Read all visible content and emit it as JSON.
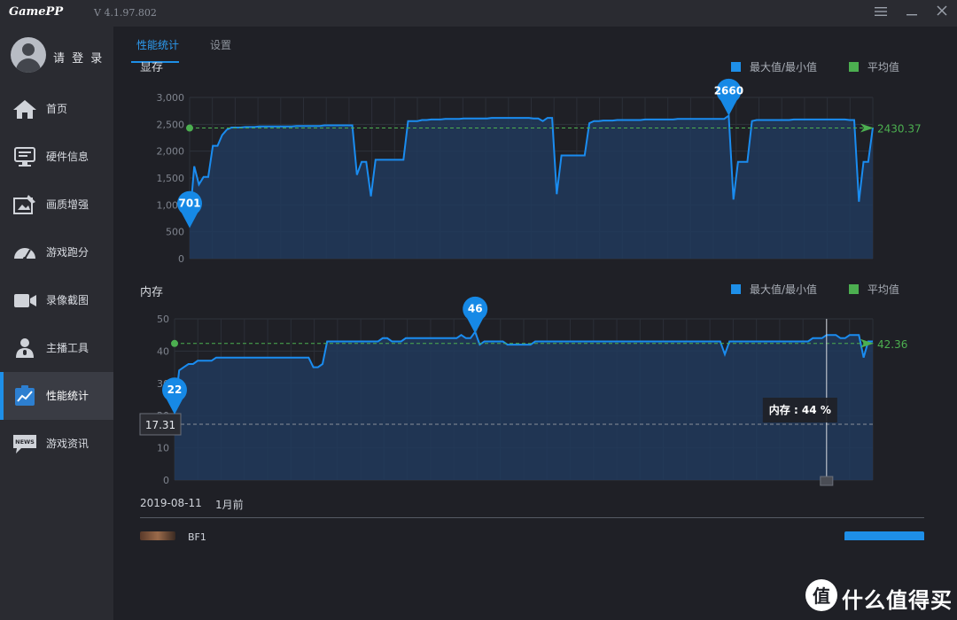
{
  "titlebar": {
    "logo": "GamePP",
    "version": "V 4.1.97.802"
  },
  "user": {
    "login_label": "请 登 录"
  },
  "sidebar": {
    "items": [
      {
        "label": "首页",
        "icon": "home-icon"
      },
      {
        "label": "硬件信息",
        "icon": "hardware-icon"
      },
      {
        "label": "画质增强",
        "icon": "image-enhance-icon"
      },
      {
        "label": "游戏跑分",
        "icon": "speedometer-icon"
      },
      {
        "label": "录像截图",
        "icon": "video-camera-icon"
      },
      {
        "label": "主播工具",
        "icon": "streamer-icon"
      },
      {
        "label": "性能统计",
        "icon": "chart-stats-icon",
        "active": true
      },
      {
        "label": "游戏资讯",
        "icon": "news-icon"
      }
    ]
  },
  "tabs": [
    {
      "label": "性能统计",
      "active": true
    },
    {
      "label": "设置"
    }
  ],
  "colors": {
    "accent": "#1e8fe8",
    "line": "#1a8cf0",
    "average": "#4caf50",
    "area": "#213a5c"
  },
  "chart_data": [
    {
      "type": "area",
      "title": "显存",
      "legend": [
        "最大值/最小值",
        "平均值"
      ],
      "legend_position": "top-right",
      "ylim": [
        0,
        3000
      ],
      "yticks": [
        "0",
        "500",
        "1,000",
        "1,500",
        "2,000",
        "2,500",
        "3,000"
      ],
      "grid": true,
      "max_marker": "2660",
      "min_marker": "701",
      "average_label": "2430.37",
      "average": 2430.37,
      "series": [
        {
          "values": [
            701,
            1720,
            1380,
            1520,
            1520,
            2100,
            2100,
            2300,
            2400,
            2440,
            2440,
            2440,
            2450,
            2450,
            2450,
            2460,
            2460,
            2460,
            2460,
            2460,
            2460,
            2460,
            2460,
            2470,
            2470,
            2470,
            2470,
            2470,
            2470,
            2480,
            2480,
            2480,
            2480,
            2480,
            2480,
            2480,
            1560,
            1800,
            1800,
            1160,
            1840,
            1840,
            1840,
            1840,
            1840,
            1840,
            1840,
            2560,
            2560,
            2560,
            2580,
            2580,
            2590,
            2590,
            2590,
            2600,
            2600,
            2600,
            2600,
            2610,
            2610,
            2610,
            2610,
            2610,
            2610,
            2620,
            2620,
            2620,
            2620,
            2620,
            2620,
            2620,
            2620,
            2620,
            2610,
            2610,
            2560,
            2620,
            2620,
            1200,
            1920,
            1920,
            1920,
            1920,
            1920,
            1920,
            2520,
            2560,
            2560,
            2570,
            2570,
            2570,
            2580,
            2580,
            2580,
            2580,
            2580,
            2580,
            2590,
            2590,
            2590,
            2590,
            2590,
            2590,
            2590,
            2600,
            2600,
            2600,
            2600,
            2600,
            2600,
            2600,
            2600,
            2600,
            2600,
            2600,
            2660,
            1100,
            1800,
            1800,
            1800,
            2560,
            2580,
            2580,
            2580,
            2580,
            2580,
            2580,
            2580,
            2580,
            2590,
            2590,
            2590,
            2590,
            2590,
            2590,
            2590,
            2590,
            2590,
            2590,
            2590,
            2590,
            2580,
            2580,
            1060,
            1800,
            1800,
            2440
          ]
        }
      ]
    },
    {
      "type": "area",
      "title": "内存",
      "legend": [
        "最大值/最小值",
        "平均值"
      ],
      "legend_position": "top-right",
      "ylim": [
        0,
        50
      ],
      "yticks": [
        "0",
        "10",
        "20",
        "30",
        "40",
        "50"
      ],
      "grid": true,
      "max_marker": "46",
      "min_marker": "22",
      "average_label": "42.36",
      "average": 42.36,
      "reference_label": "17.31",
      "reference": 17.31,
      "tooltip": "内存 : 44 %",
      "tooltip_index": 141,
      "series": [
        {
          "values": [
            22,
            34,
            35,
            36,
            36,
            37,
            37,
            37,
            37,
            38,
            38,
            38,
            38,
            38,
            38,
            38,
            38,
            38,
            38,
            38,
            38,
            38,
            38,
            38,
            38,
            38,
            38,
            38,
            38,
            38,
            35,
            35,
            36,
            43,
            43,
            43,
            43,
            43,
            43,
            43,
            43,
            43,
            43,
            43,
            43,
            44,
            44,
            43,
            43,
            43,
            44,
            44,
            44,
            44,
            44,
            44,
            44,
            44,
            44,
            44,
            44,
            44,
            45,
            44,
            44,
            46,
            42,
            43,
            43,
            43,
            43,
            43,
            42,
            42,
            42,
            42,
            42,
            42,
            43,
            43,
            43,
            43,
            43,
            43,
            43,
            43,
            43,
            43,
            43,
            43,
            43,
            43,
            43,
            43,
            43,
            43,
            43,
            43,
            43,
            43,
            43,
            43,
            43,
            43,
            43,
            43,
            43,
            43,
            43,
            43,
            43,
            43,
            43,
            43,
            43,
            43,
            43,
            43,
            43,
            39,
            43,
            43,
            43,
            43,
            43,
            43,
            43,
            43,
            43,
            43,
            43,
            43,
            43,
            43,
            43,
            43,
            43,
            43,
            44,
            44,
            44,
            45,
            45,
            45,
            44,
            44,
            45,
            45,
            45,
            38,
            43,
            43
          ]
        }
      ]
    }
  ],
  "session": {
    "date": "2019-08-11",
    "ago": "1月前",
    "game": "BF1"
  },
  "watermark": {
    "text": "什么值得买",
    "logo_text": "值"
  }
}
